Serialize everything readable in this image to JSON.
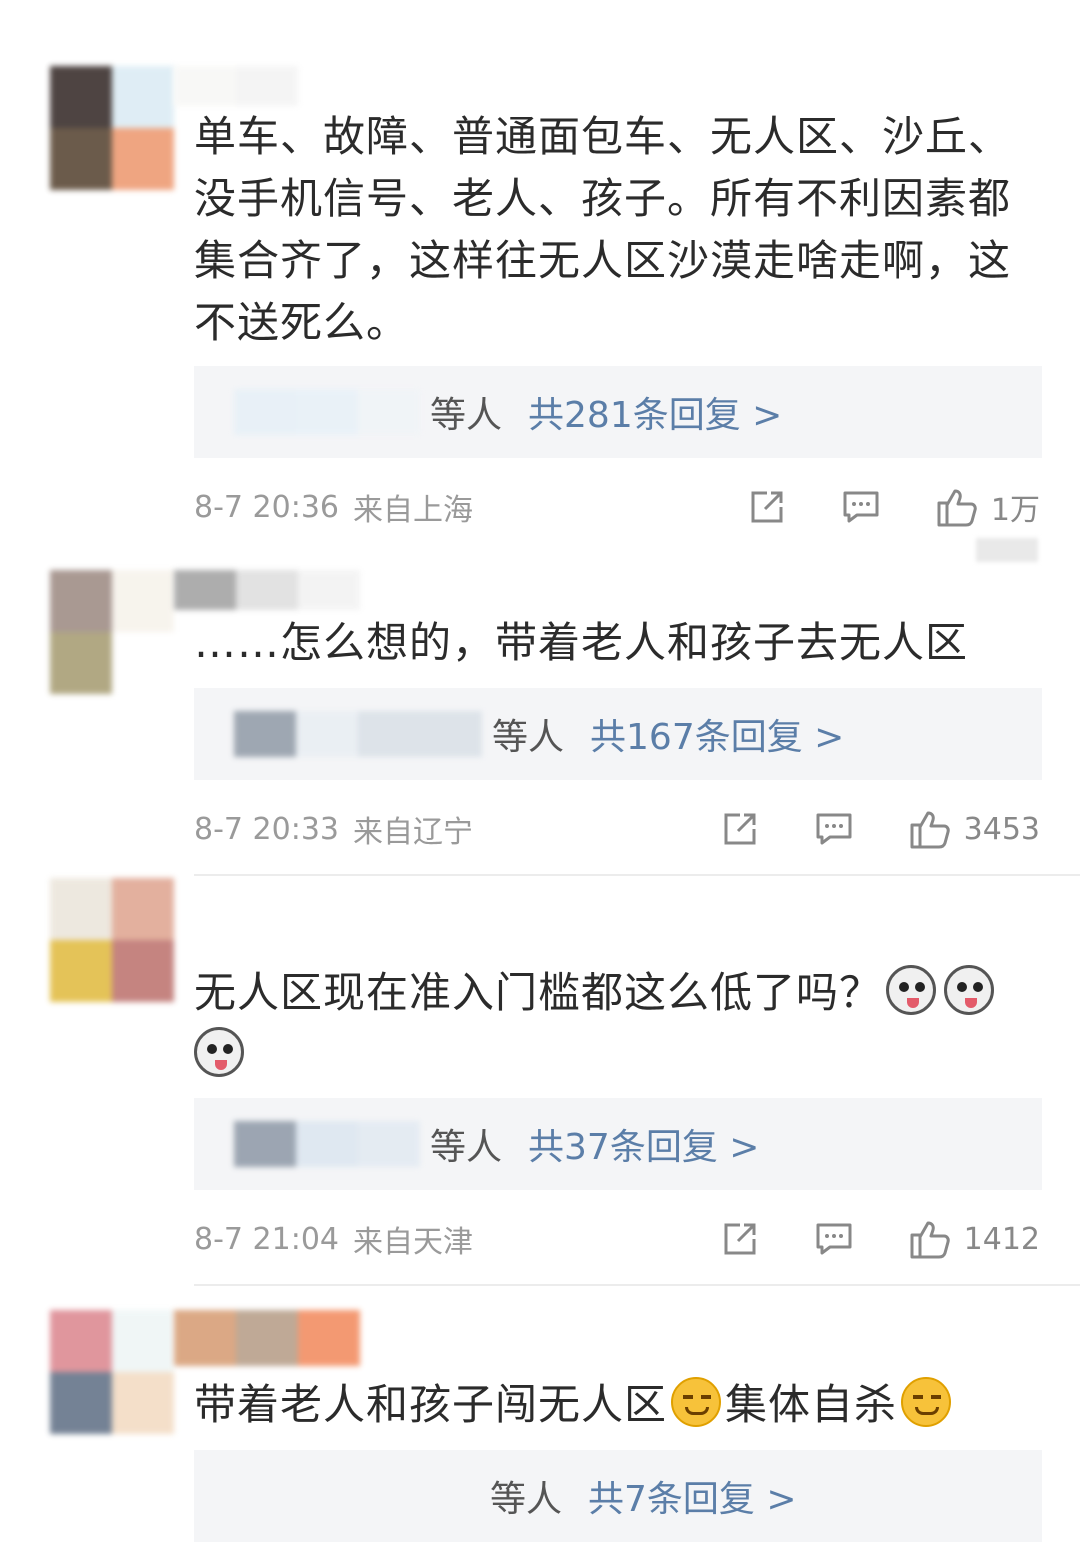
{
  "comments": [
    {
      "avatar_colors": [
        "#3b302e",
        "#dcecf4",
        "#5c4a38",
        "#ee9c74"
      ],
      "name_colors": [
        "#f7f7f5",
        "#f3f3f3",
        "#ffffff",
        "#ffffff"
      ],
      "text": "单车、故障、普通面包车、无人区、沙丘、没手机信号、老人、孩子。所有不利因素都集合齐了，这样往无人区沙漠走啥走啊，这不送死么。",
      "reply_blur_colors": [
        "#e6f0f7",
        "#e8f1f8",
        "#f0f4f7"
      ],
      "reply_who": "等人",
      "reply_count": "共281条回复 >",
      "time": "8-7 20:36",
      "location": "来自上海",
      "likes": "1万"
    },
    {
      "avatar_colors": [
        "#a08e87",
        "#f7f3ec",
        "#a99f76",
        "#ffffff"
      ],
      "name_colors": [
        "#9f9f9f",
        "#dddddd",
        "#f2f2f2",
        "#ffffff"
      ],
      "text": "……怎么想的，带着老人和孩子去无人区",
      "reply_blur_colors": [
        "#909aa6",
        "#e9eef3",
        "#d9e0e7"
      ],
      "reply_who": "等人",
      "reply_count": "共167条回复 >",
      "time": "8-7 20:33",
      "location": "来自辽宁",
      "likes": "3453"
    },
    {
      "avatar_colors": [
        "#ece6dc",
        "#e0a894",
        "#e2bd46",
        "#bf7773"
      ],
      "name_colors": [
        "#ffffff",
        "#ffffff",
        "#ffffff",
        "#ffffff"
      ],
      "text_before": "无人区现在准入门槛都这么低了吗？",
      "reply_blur_colors": [
        "#8d98a6",
        "#dce6f0",
        "#e2eaf2"
      ],
      "reply_who": "等人",
      "reply_count": "共37条回复 >",
      "time": "8-7 21:04",
      "location": "来自天津",
      "likes": "1412"
    },
    {
      "avatar_colors": [
        "#dd8b93",
        "#eff6f6",
        "#66758a",
        "#f3dcc4"
      ],
      "name_colors": [
        "#d59a70",
        "#b49b84",
        "#f2885a",
        "#ffffff"
      ],
      "text_part1": "带着老人和孩子闯无人区",
      "text_part2": "集体自杀",
      "reply_blur_colors": [
        "#f4f5f7",
        "#f4f5f7",
        "#f4f5f7"
      ],
      "reply_who": "等人",
      "reply_count": "共7条回复 >"
    }
  ]
}
